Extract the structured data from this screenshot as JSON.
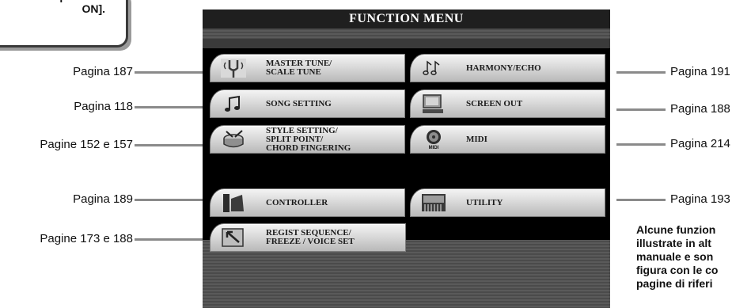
{
  "callout": {
    "text": "l pulsante\nON]."
  },
  "screen": {
    "title": "FUNCTION MENU",
    "left_items": [
      {
        "label": "MASTER TUNE/\nSCALE TUNE",
        "icon": "tuning-fork-icon"
      },
      {
        "label": "SONG SETTING",
        "icon": "music-note-icon"
      },
      {
        "label": "STYLE SETTING/\nSPLIT POINT/\nCHORD FINGERING",
        "icon": "drum-icon"
      },
      {
        "label": "CONTROLLER",
        "icon": "pedal-icon"
      },
      {
        "label": "REGIST SEQUENCE/\nFREEZE / VOICE SET",
        "icon": "registration-icon"
      }
    ],
    "right_items": [
      {
        "label": "HARMONY/ECHO",
        "icon": "double-note-icon"
      },
      {
        "label": "SCREEN OUT",
        "icon": "monitor-icon"
      },
      {
        "label": "MIDI",
        "icon": "midi-icon"
      },
      {
        "label": "UTILITY",
        "icon": "keyboard-icon"
      }
    ]
  },
  "left_refs": [
    "Pagina 187",
    "Pagina 118",
    "Pagine 152 e 157",
    "Pagina 189",
    "Pagine 173 e 188"
  ],
  "right_refs": [
    "Pagina 191",
    "Pagina 188",
    "Pagina 214",
    "Pagina 193"
  ],
  "note": "Alcune funzion\nillustrate in alt\nmanuale e son\nfigura con le co\npagine di riferi"
}
